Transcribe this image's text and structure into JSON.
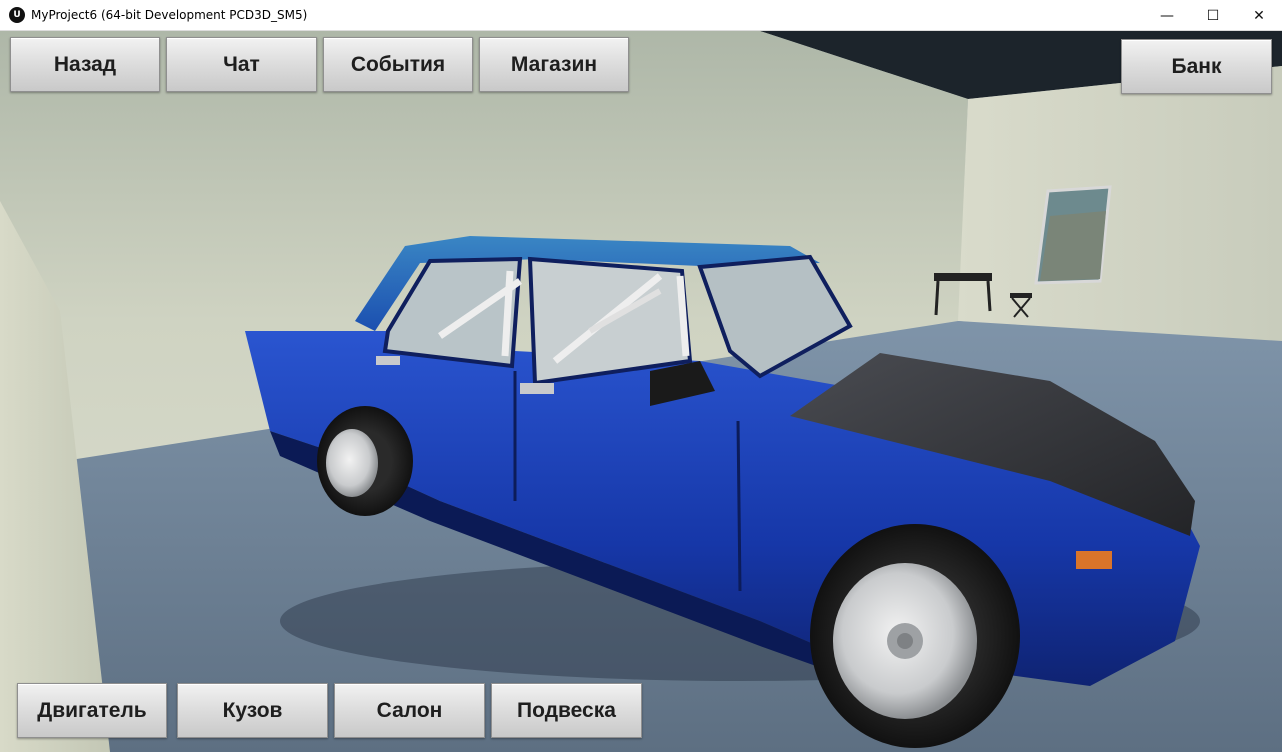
{
  "window": {
    "title": "MyProject6 (64-bit Development PCD3D_SM5)",
    "icon": "unreal-engine-icon",
    "minimize_glyph": "—",
    "maximize_glyph": "☐",
    "close_glyph": "✕"
  },
  "top_nav": {
    "back_label": "Назад",
    "chat_label": "Чат",
    "events_label": "События",
    "shop_label": "Магазин",
    "bank_label": "Банк"
  },
  "bottom_nav": {
    "engine_label": "Двигатель",
    "body_label": "Кузов",
    "interior_label": "Салон",
    "suspension_label": "Подвеска"
  },
  "colors": {
    "car_body": "#1a3fb0",
    "car_hood": "#2b2d31",
    "wall": "#d4d8c6",
    "floor": "#6b7f94",
    "button_face": "#dedede"
  }
}
